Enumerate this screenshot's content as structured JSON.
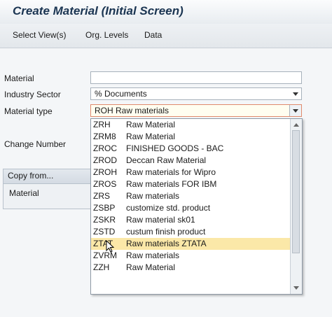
{
  "header": {
    "title": "Create Material (Initial Screen)"
  },
  "menu": {
    "items": [
      {
        "label": "Select View(s)"
      },
      {
        "label": "Org. Levels"
      },
      {
        "label": "Data"
      }
    ]
  },
  "form": {
    "material_label": "Material",
    "material_value": "",
    "industry_label": "Industry Sector",
    "industry_value": "% Documents",
    "material_type_label": "Material type",
    "material_type_value": "ROH Raw materials",
    "change_number_label": "Change Number"
  },
  "copy_from": {
    "title": "Copy from...",
    "material_label": "Material"
  },
  "dropdown": {
    "items": [
      {
        "code": "ZRH",
        "text": "Raw Material"
      },
      {
        "code": "ZRM8",
        "text": "Raw Material"
      },
      {
        "code": "ZROC",
        "text": "FINISHED GOODS - BAC"
      },
      {
        "code": "ZROD",
        "text": "Deccan Raw Material"
      },
      {
        "code": "ZROH",
        "text": "Raw materials for Wipro"
      },
      {
        "code": "ZROS",
        "text": "Raw materials FOR IBM"
      },
      {
        "code": "ZRS",
        "text": "Raw materials"
      },
      {
        "code": "ZSBP",
        "text": "customize std. product"
      },
      {
        "code": "ZSKR",
        "text": "Raw material sk01"
      },
      {
        "code": "ZSTD",
        "text": "custum finish product"
      },
      {
        "code": "ZTAT",
        "text": "Raw materials ZTATA"
      },
      {
        "code": "ZVRM",
        "text": "Raw materials"
      },
      {
        "code": "ZZH",
        "text": "Raw Material"
      }
    ],
    "selected_code": "ZTAT"
  },
  "colors": {
    "title": "#1b3552",
    "selected_row": "#fbe8a8",
    "focus_border": "#e08a6c"
  }
}
